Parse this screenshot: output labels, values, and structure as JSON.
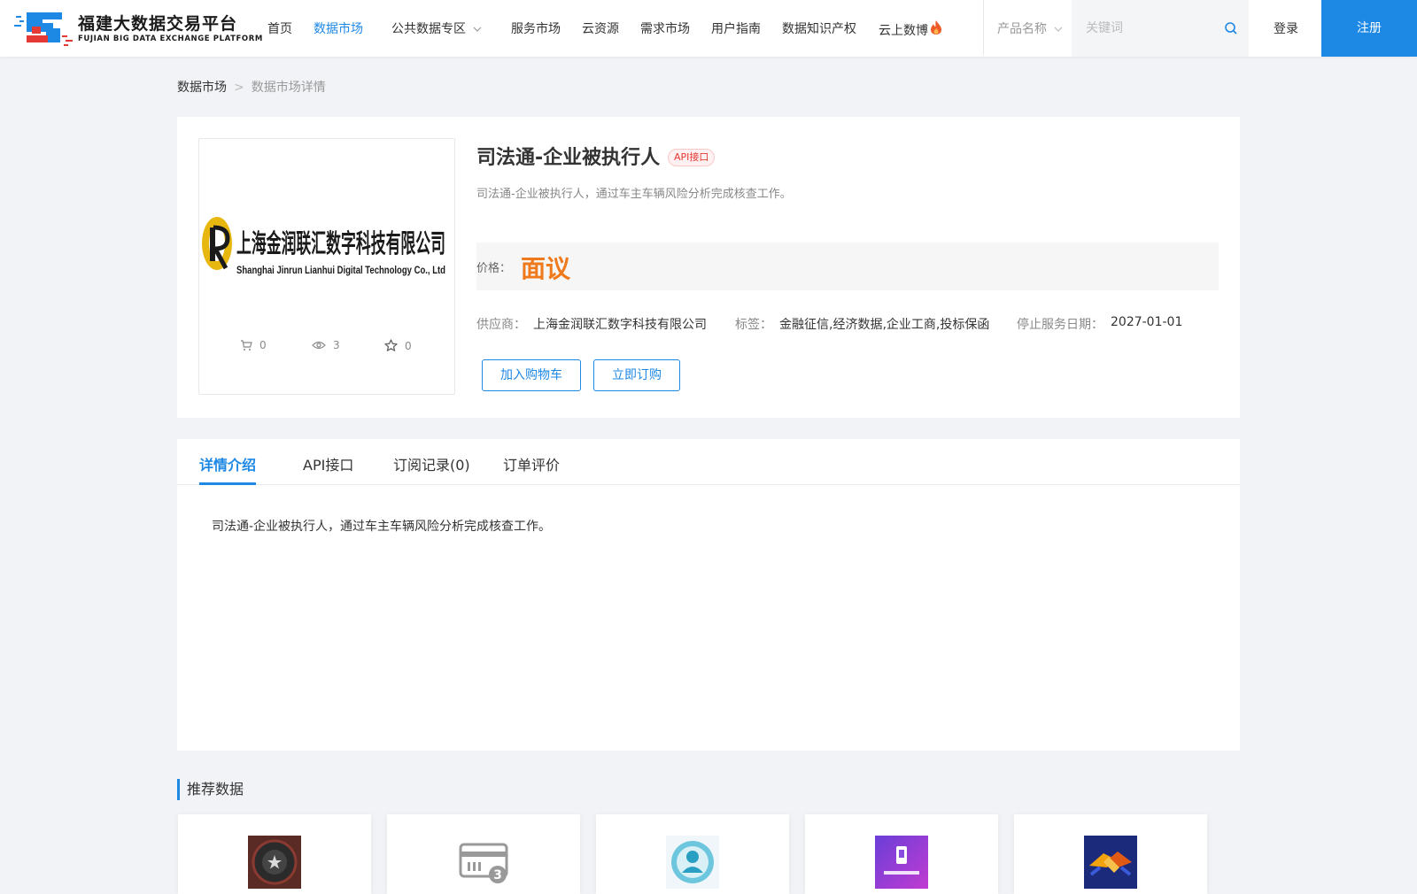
{
  "header": {
    "logo_cn": "福建大数据交易平台",
    "logo_en": "FUJIAN BIG DATA EXCHANGE  PLATFORM",
    "nav": [
      {
        "label": "首页",
        "active": false
      },
      {
        "label": "数据市场",
        "active": true
      },
      {
        "label": "公共数据专区",
        "active": false,
        "dropdown": true
      },
      {
        "label": "服务市场",
        "active": false
      },
      {
        "label": "云资源",
        "active": false
      },
      {
        "label": "需求市场",
        "active": false
      },
      {
        "label": "用户指南",
        "active": false
      },
      {
        "label": "数据知识产权",
        "active": false
      },
      {
        "label": "云上数博",
        "active": false,
        "icon": "flame-icon"
      }
    ],
    "search": {
      "category": "产品名称",
      "placeholder": "关键词",
      "value": ""
    },
    "login": "登录",
    "register": "注册"
  },
  "breadcrumb": {
    "root": "数据市场",
    "separator": ">",
    "current": "数据市场详情"
  },
  "product": {
    "thumbnail": {
      "company_cn": "上海金润联汇数字科技有限公司",
      "company_en": "Shanghai Jinrun Lianhui Digital Technology Co., Ltd"
    },
    "stats": {
      "cart": "0",
      "views": "3",
      "favorites": "0"
    },
    "title": "司法通-企业被执行人",
    "badge": "API接口",
    "description": "司法通-企业被执行人，通过车主车辆风险分析完成核查工作。",
    "price_label": "价格：",
    "price_value": "面议",
    "supplier_label": "供应商：",
    "supplier": "上海金润联汇数字科技有限公司",
    "tags_label": "标签：",
    "tags": "金融征信,经济数据,企业工商,投标保函",
    "stop_date_label": "停止服务日期：",
    "stop_date": "2027-01-01",
    "add_cart": "加入购物车",
    "buy_now": "立即订购"
  },
  "tabs": {
    "items": [
      "详情介绍",
      "API接口",
      "订阅记录(0)",
      "订单评价"
    ],
    "active_index": 0,
    "content": "司法通-企业被执行人，通过车主车辆风险分析完成核查工作。"
  },
  "recommend": {
    "title": "推荐数据"
  },
  "colors": {
    "primary": "#1e88e5",
    "price": "#f0791c",
    "badge": "#e53935"
  }
}
